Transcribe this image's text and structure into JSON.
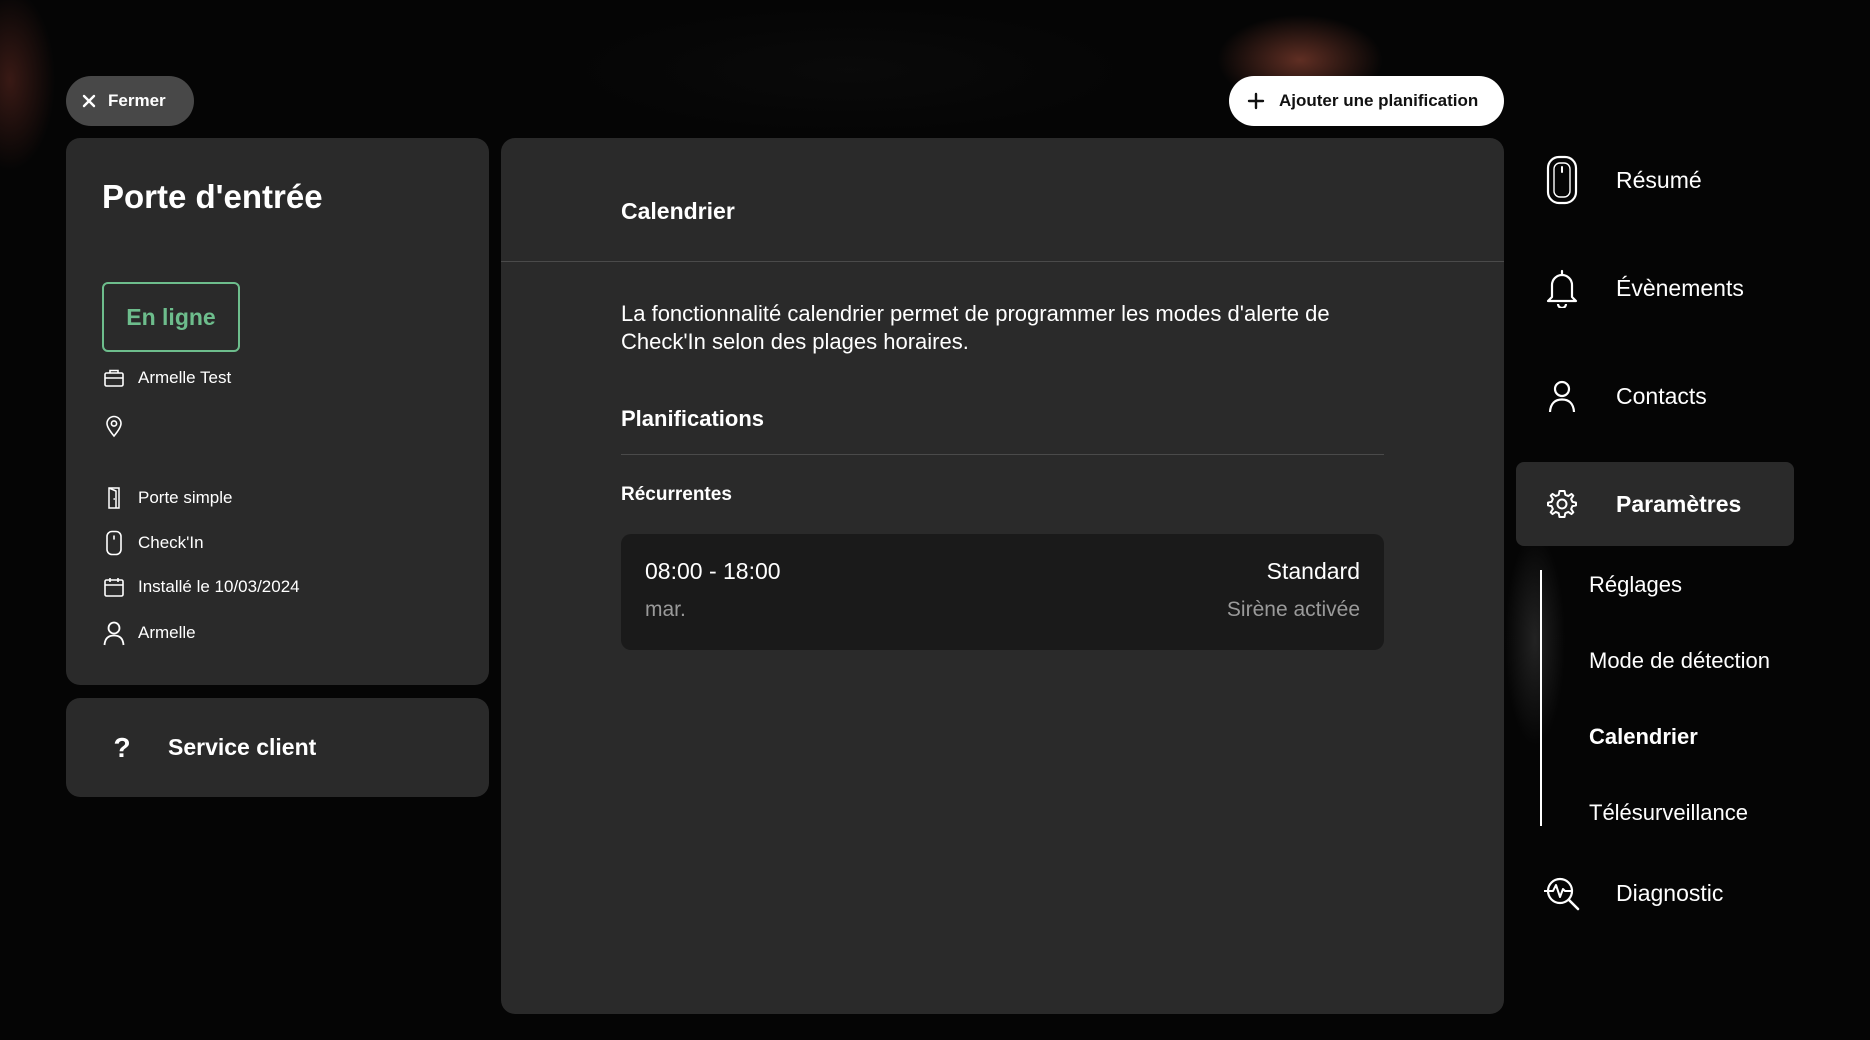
{
  "toolbar": {
    "close_label": "Fermer",
    "add_label": "Ajouter une planification"
  },
  "device": {
    "title": "Porte d'entrée",
    "status": "En ligne",
    "account": "Armelle Test",
    "location": "",
    "door_type": "Porte simple",
    "product": "Check'In",
    "installed": "Installé le 10/03/2024",
    "user": "Armelle"
  },
  "support": {
    "label": "Service client"
  },
  "main": {
    "title": "Calendrier",
    "description": "La fonctionnalité calendrier permet de programmer les modes d'alerte de Check'In selon des plages horaires.",
    "section_title": "Planifications",
    "subsection_title": "Récurrentes",
    "schedules": [
      {
        "time": "08:00 - 18:00",
        "day": "mar.",
        "mode": "Standard",
        "status": "Sirène activée"
      }
    ]
  },
  "nav": {
    "items": [
      {
        "label": "Résumé",
        "icon": "device-icon"
      },
      {
        "label": "Évènements",
        "icon": "bell-icon"
      },
      {
        "label": "Contacts",
        "icon": "person-icon"
      },
      {
        "label": "Paramètres",
        "icon": "gear-icon",
        "active": true
      },
      {
        "label": "Diagnostic",
        "icon": "diagnostic-icon"
      }
    ],
    "sub_items": [
      {
        "label": "Réglages"
      },
      {
        "label": "Mode de détection"
      },
      {
        "label": "Calendrier",
        "active": true
      },
      {
        "label": "Télésurveillance"
      }
    ]
  }
}
